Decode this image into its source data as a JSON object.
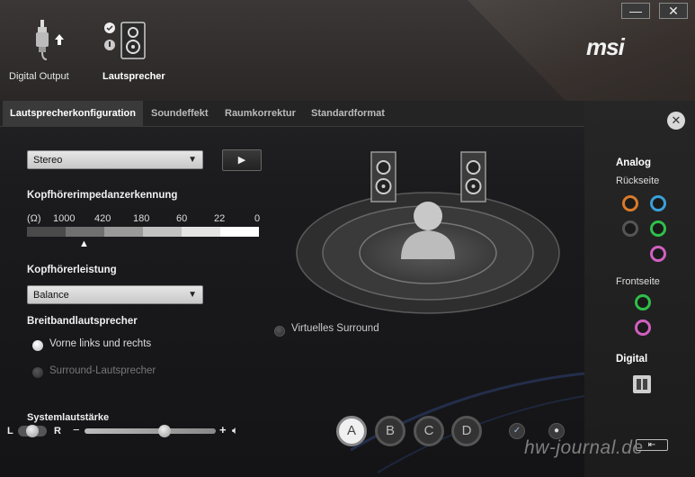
{
  "header": {
    "devices": [
      {
        "label": "Digital Output",
        "icon": "digital-output-plug-icon"
      },
      {
        "label": "Lautsprecher",
        "icon": "speaker-icon",
        "selected": true
      }
    ],
    "logo": "msi",
    "window_buttons": {
      "minimize": "—",
      "close": "✕"
    }
  },
  "tabs": [
    {
      "label": "Lautsprecherkonfiguration",
      "active": true
    },
    {
      "label": "Soundeffekt"
    },
    {
      "label": "Raumkorrektur"
    },
    {
      "label": "Standardformat"
    }
  ],
  "speaker_config": {
    "selected": "Stereo",
    "play_label": "▶"
  },
  "impedance": {
    "title": "Kopfhörerimpedanzerkennung",
    "unit": "(Ω)",
    "ticks": [
      "1000",
      "420",
      "180",
      "60",
      "22",
      "0"
    ],
    "indicator": "▲"
  },
  "headphone_power": {
    "title": "Kopfhörerleistung",
    "selected": "Balance"
  },
  "fullrange": {
    "title": "Breitbandlautsprecher",
    "options": [
      {
        "label": "Vorne links und rechts",
        "checked": true
      },
      {
        "label": "Surround-Lautsprecher",
        "checked": false,
        "disabled": true
      }
    ]
  },
  "virtual_surround": {
    "label": "Virtuelles Surround",
    "checked": false
  },
  "system_volume": {
    "title": "Systemlautstärke",
    "left": "L",
    "right": "R",
    "minus": "−",
    "plus": "+",
    "level": 0.62
  },
  "bottom_buttons": [
    {
      "label": "A",
      "active": true
    },
    {
      "label": "B"
    },
    {
      "label": "C"
    },
    {
      "label": "D"
    }
  ],
  "right_panel": {
    "analog": "Analog",
    "rear": "Rückseite",
    "front": "Frontseite",
    "digital": "Digital",
    "rear_jack_colors": [
      "#d97a2a",
      "#3aa0d8",
      "#555555",
      "#2fbf4a",
      "#d060c0"
    ],
    "front_jack_colors": [
      "#2fbf4a",
      "#d060c0"
    ]
  },
  "watermark": "hw-journal.de",
  "colors": {
    "accent": "#ffffff",
    "panel": "#1c1c1c"
  }
}
